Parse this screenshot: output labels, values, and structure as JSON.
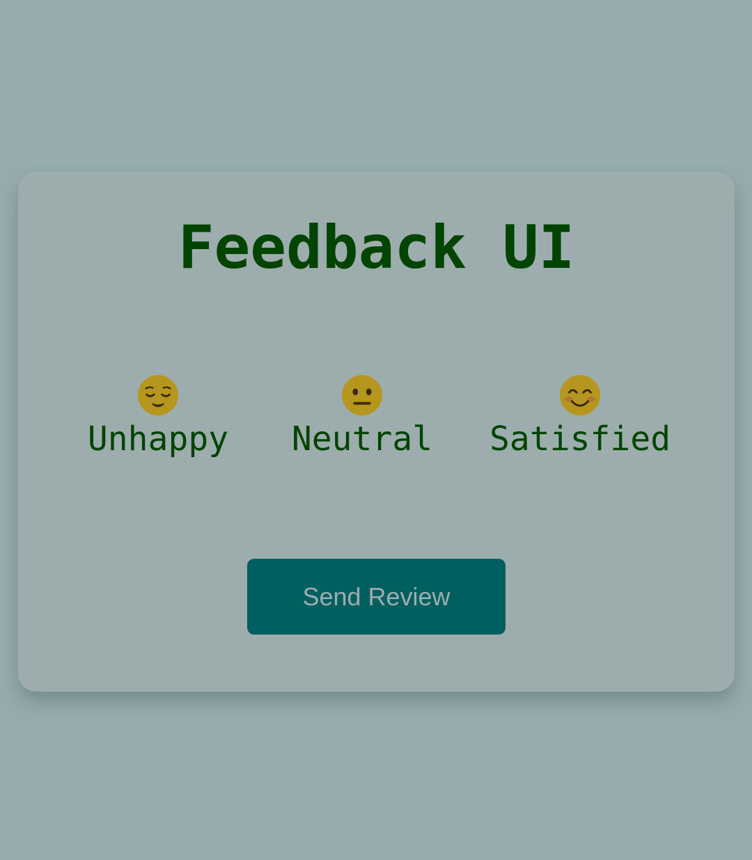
{
  "card": {
    "title": "Feedback UI"
  },
  "options": [
    {
      "label": "Unhappy",
      "icon": "relieved-face-icon"
    },
    {
      "label": "Neutral",
      "icon": "neutral-face-icon"
    },
    {
      "label": "Satisfied",
      "icon": "smiling-face-icon"
    }
  ],
  "actions": {
    "send_label": "Send Review"
  },
  "colors": {
    "background": "#96acae",
    "card": "#9dadad",
    "text": "#004400",
    "button": "#005f5f",
    "button_text": "#9dadad",
    "emoji_face": "#b5961e"
  }
}
